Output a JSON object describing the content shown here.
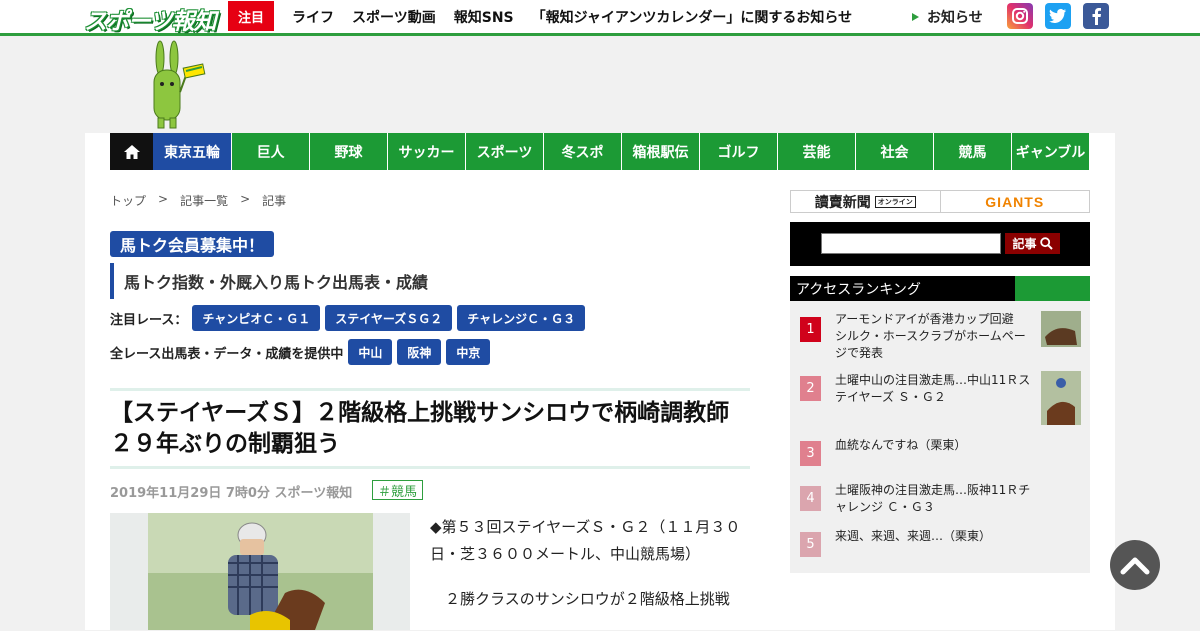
{
  "header": {
    "logo_text": "スポーツ報知",
    "hot_label": "注目",
    "nav": [
      "ライフ",
      "スポーツ動画",
      "報知SNS",
      "「報知ジャイアンツカレンダー」に関するお知らせ"
    ],
    "notice_label": "お知らせ",
    "sns": [
      {
        "name": "instagram",
        "glyph": "◎"
      },
      {
        "name": "twitter",
        "glyph": "✔"
      },
      {
        "name": "facebook",
        "glyph": "f"
      }
    ]
  },
  "main_nav": {
    "items": [
      "東京五輪",
      "巨人",
      "野球",
      "サッカー",
      "スポーツ",
      "冬スポ",
      "箱根駅伝",
      "ゴルフ",
      "芸能",
      "社会",
      "競馬",
      "ギャンブル"
    ]
  },
  "breadcrumb": [
    "トップ",
    ">",
    "記事一覧",
    ">",
    "記事"
  ],
  "promo": {
    "title": "馬トク会員募集中！",
    "subtitle": "馬トク指数・外厩入り馬トク出馬表・成績",
    "featured_label": "注目レース：",
    "featured_races": [
      "チャンピオＣ・Ｇ１",
      "ステイヤーズＳＧ２",
      "チャレンジＣ・Ｇ３"
    ],
    "all_races_label": "全レース出馬表・データ・成績を提供中",
    "venues": [
      "中山",
      "阪神",
      "中京"
    ]
  },
  "article": {
    "headline": "【ステイヤーズＳ】２階級格上挑戦サンシロウで柄崎調教師２９年ぶりの制覇狙う",
    "meta": "2019年11月29日 7時0分  スポーツ報知",
    "category": "＃競馬",
    "paragraphs": [
      "◆第５３回ステイヤーズＳ・Ｇ２（１１月３０日・芝３６００メートル、中山競馬場）",
      "２勝クラスのサンシロウが２階級格上挑戦"
    ]
  },
  "sidebar": {
    "ad_left": "讀賣新聞",
    "ad_left_badge": "オンライン",
    "ad_right": "GIANTS",
    "search_button": "記事",
    "ranking_title": "アクセスランキング",
    "ranking": [
      {
        "rank": "1",
        "text": "アーモンドアイが香港カップ回避　シルク・ホースクラブがホームページで発表",
        "color": "#d0021b",
        "thumb": true
      },
      {
        "rank": "2",
        "text": "土曜中山の注目激走馬…中山11Ｒステイヤーズ Ｓ・Ｇ２",
        "color": "#e0808e",
        "thumb": true
      },
      {
        "rank": "3",
        "text": "血統なんですね（栗東）",
        "color": "#e0808e",
        "thumb": false
      },
      {
        "rank": "4",
        "text": "土曜阪神の注目激走馬…阪神11Ｒチャレンジ Ｃ・Ｇ３",
        "color": "#dba5ae",
        "thumb": false
      },
      {
        "rank": "5",
        "text": "来週、来週、来週…（栗東）",
        "color": "#dba5ae",
        "thumb": false
      }
    ]
  },
  "colors": {
    "brand_green": "#1c9a35",
    "brand_blue": "#1f4ca3",
    "hot_red": "#e60012"
  }
}
